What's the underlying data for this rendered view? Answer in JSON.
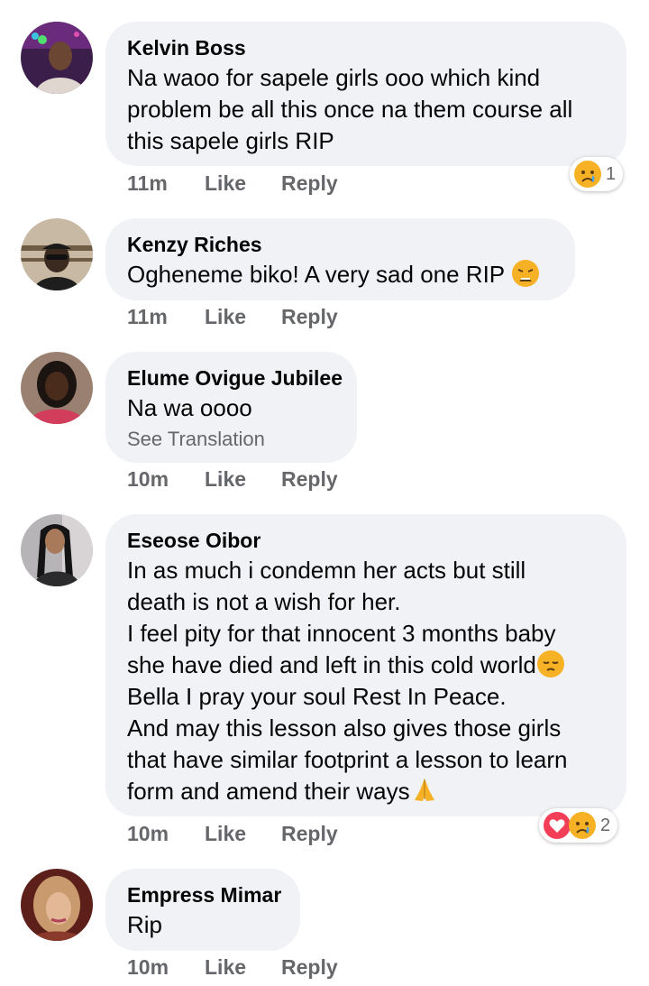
{
  "comments": [
    {
      "author": "Kelvin Boss",
      "lines": [
        "Na waoo for sapele girls ooo which kind",
        "problem be all this once na them course all",
        "this sapele girls RIP"
      ],
      "time": "11m",
      "like_label": "Like",
      "reply_label": "Reply",
      "reactions": [
        "sad-cry-icon"
      ],
      "reaction_count": "1"
    },
    {
      "author": "Kenzy Riches",
      "lines": [
        "Ogheneme biko! A very sad one RIP"
      ],
      "trailing_emoji": "weary-face-icon",
      "time": "11m",
      "like_label": "Like",
      "reply_label": "Reply"
    },
    {
      "author": "Elume Ovigue Jubilee",
      "lines": [
        "Na wa oooo"
      ],
      "see_translation": "See Translation",
      "time": "10m",
      "like_label": "Like",
      "reply_label": "Reply"
    },
    {
      "author": "Eseose Oibor",
      "lines": [
        "In as much i condemn her acts but still",
        "death is not a wish for her.",
        "I feel pity for that innocent 3 months baby",
        "she have died and left in this cold world",
        "Bella I pray your soul Rest In Peace.",
        "And may this lesson also gives those girls",
        "that have similar footprint a lesson to learn",
        "form and amend their ways"
      ],
      "line_emojis": {
        "3": "pensive-face-icon",
        "7": "folded-hands-icon"
      },
      "time": "10m",
      "like_label": "Like",
      "reply_label": "Reply",
      "reactions": [
        "love-heart-icon",
        "sad-cry-icon"
      ],
      "reaction_count": "2"
    },
    {
      "author": "Empress Mimar",
      "lines": [
        "Rip"
      ],
      "time": "10m",
      "like_label": "Like",
      "reply_label": "Reply"
    }
  ],
  "colors": {
    "bubble": "#f0f2f5",
    "secondary_text": "#65676b",
    "love_red": "#f33e58",
    "emoji_yellow": "#f7b125"
  }
}
